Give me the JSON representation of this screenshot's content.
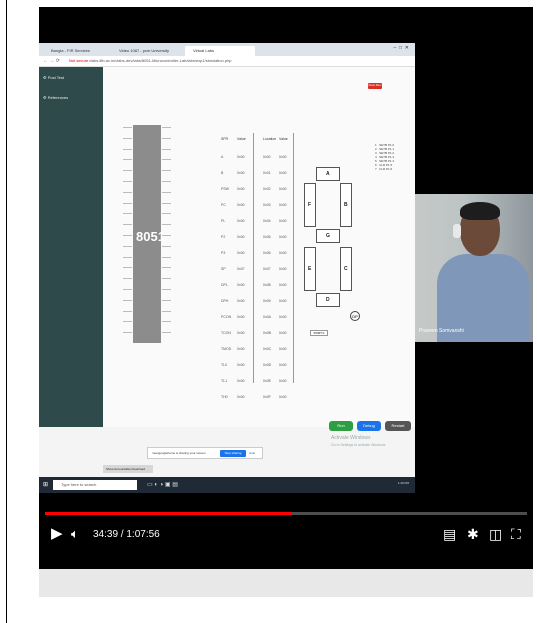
{
  "player": {
    "current_time": "34:39",
    "duration": "1:07:56",
    "time_separator": " / ",
    "progress": 0.51,
    "colors": {
      "played": "#ff0000",
      "background": "#000000"
    }
  },
  "browser": {
    "tabs": [
      "Bangla - FIR Services",
      "Video 1087 - pcm University",
      "Virtual Labs"
    ],
    "warning": "Not secure",
    "url": "vlabs.iitb.ac.in/vlabs-dev/labs/8051-Microcontroller-Lab/labs/exp1/simulation.php"
  },
  "sidebar": {
    "items": [
      {
        "label": "Post Test",
        "icon": "gear-icon"
      },
      {
        "label": "References",
        "icon": "gear-icon"
      }
    ]
  },
  "simulator": {
    "chip_label": "8051",
    "reset_label": "Reset Mem",
    "sfr_headers": [
      "SFR",
      "Value",
      "Location",
      "Value"
    ],
    "sfr_rows": [
      [
        "A",
        "0x00",
        "0x00",
        "0x00"
      ],
      [
        "B",
        "0x00",
        "0x01",
        "0x00"
      ],
      [
        "PSW",
        "0x00",
        "0x02",
        "0x00"
      ],
      [
        "PC",
        "0x00",
        "0x03",
        "0x00"
      ],
      [
        "PL",
        "0x00",
        "0x04",
        "0x00"
      ],
      [
        "P2",
        "0x00",
        "0x05",
        "0x00"
      ],
      [
        "P3",
        "0x00",
        "0x06",
        "0x00"
      ],
      [
        "SP",
        "0x07",
        "0x07",
        "0x00"
      ],
      [
        "DPL",
        "0x00",
        "0x08",
        "0x00"
      ],
      [
        "DPH",
        "0x00",
        "0x09",
        "0x00"
      ],
      [
        "PCON",
        "0x00",
        "0x0A",
        "0x00"
      ],
      [
        "TCON",
        "0x00",
        "0x0B",
        "0x00"
      ],
      [
        "TMOD",
        "0x00",
        "0x0C",
        "0x00"
      ],
      [
        "TL0",
        "0x00",
        "0x0D",
        "0x00"
      ],
      [
        "TL1",
        "0x00",
        "0x0E",
        "0x00"
      ],
      [
        "TH0",
        "0x00",
        "0x0F",
        "0x00"
      ]
    ],
    "segments": [
      "A",
      "B",
      "C",
      "D",
      "E",
      "F",
      "G"
    ],
    "dp_label": "DP",
    "port_select": "PORT 0",
    "code_lines": "1   SETB P1.0\n2   SETB P1.1\n3   SETB P1.2\n4   SETB P1.3\n5   SETB P1.4\n6   CLR P1.5\n7   CLR P1.6",
    "buttons": {
      "run": "Run",
      "debug": "Debug",
      "reset": "Restart"
    }
  },
  "share_bar": {
    "text": "meetgooglehome is sharing your screen.",
    "stop": "Stop sharing",
    "hide": "Hide"
  },
  "watermark": {
    "title": "Activate Windows",
    "subtitle": "Go to Settings to activate Windows."
  },
  "taskbar": {
    "search_placeholder": "Type here to search",
    "clock": "1:40 PM"
  },
  "bottom_tab": "Show Accountable Download",
  "cam": {
    "name": "Praveen Somvanshi"
  }
}
